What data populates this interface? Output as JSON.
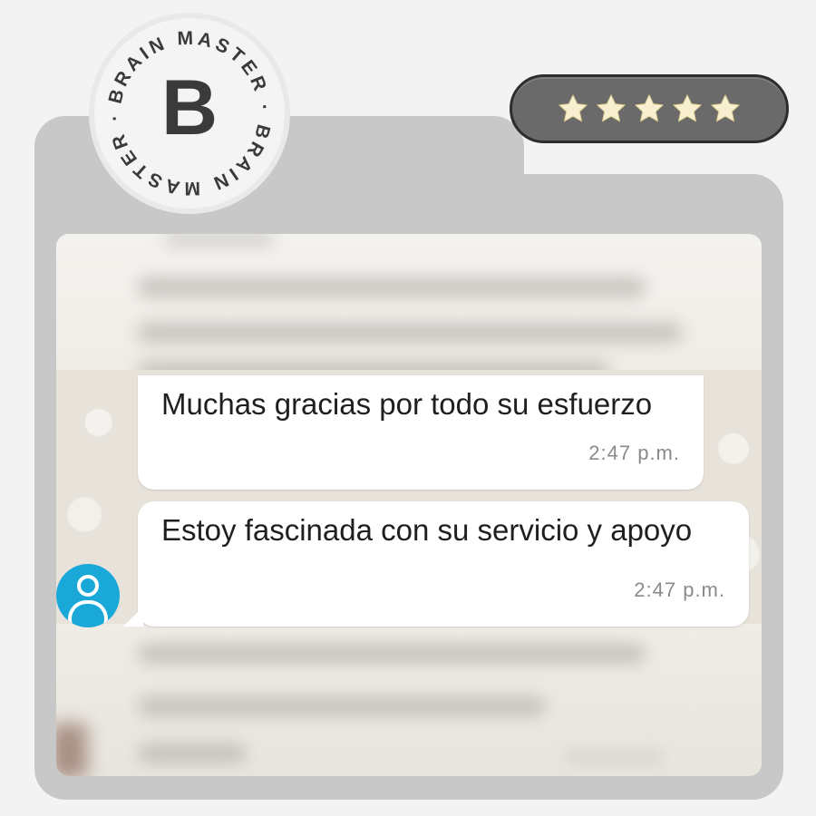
{
  "logo": {
    "letter": "B",
    "ring_text": "BRAIN MASTER · BRAIN MASTER ·"
  },
  "rating": {
    "stars": 5,
    "max_stars": 5,
    "star_color": "#f7efd0"
  },
  "messages": [
    {
      "text": "Muchas gracias por todo su esfuerzo",
      "time": "2:47 p.m."
    },
    {
      "text": "Estoy fascinada con su servicio y apoyo",
      "time": "2:47 p.m."
    }
  ],
  "colors": {
    "folder": "#c8c8c8",
    "avatar": "#1aa8d8",
    "bubble": "#ffffff"
  },
  "icons": {
    "avatar": "user-icon",
    "star": "star-icon"
  }
}
